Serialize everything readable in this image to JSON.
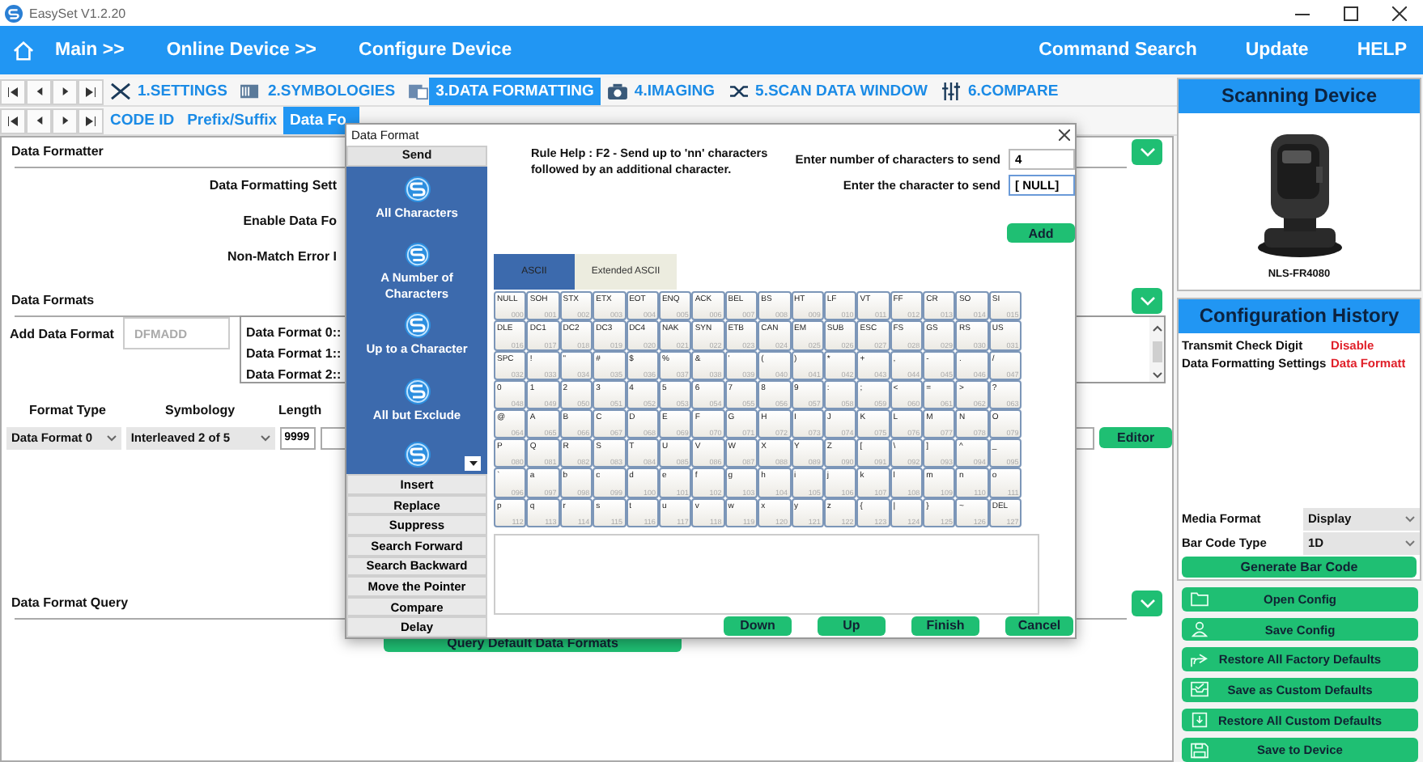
{
  "window": {
    "title": "EasySet V1.2.20"
  },
  "nav": {
    "left": [
      "Main >>",
      "Online Device >>",
      "Configure Device"
    ],
    "right": [
      "Command Search",
      "Update",
      "HELP"
    ]
  },
  "tabs": [
    {
      "label": "1.SETTINGS",
      "selected": false
    },
    {
      "label": "2.SYMBOLOGIES",
      "selected": false
    },
    {
      "label": "3.DATA FORMATTING",
      "selected": true
    },
    {
      "label": "4.IMAGING",
      "selected": false
    },
    {
      "label": "5.SCAN DATA WINDOW",
      "selected": false
    },
    {
      "label": "6.COMPARE",
      "selected": false
    }
  ],
  "subtabs": [
    {
      "label": "CODE ID",
      "selected": false
    },
    {
      "label": "Prefix/Suffix",
      "selected": false
    },
    {
      "label": "Data Fo",
      "selected": true
    }
  ],
  "formatter": {
    "title": "Data Formatter",
    "labels": [
      "Data Formatting Sett",
      "Enable Data Fo",
      "Non-Match Error I"
    ]
  },
  "formats": {
    "title": "Data Formats",
    "add_label": "Add Data Format",
    "add_placeholder": "DFMADD",
    "list": [
      "Data Format 0::",
      "Data Format 1::",
      "Data Format 2::"
    ],
    "columns": [
      "Format Type",
      "Symbology",
      "Length"
    ],
    "format_type": "Data Format 0",
    "symbology": "Interleaved 2 of 5",
    "length": "9999",
    "editor": "Editor"
  },
  "query": {
    "title": "Data Format Query",
    "button": "Query Default Data Formats"
  },
  "device": {
    "title": "Scanning Device",
    "model": "NLS-FR4080"
  },
  "history": {
    "title": "Configuration History",
    "rows": [
      {
        "setting": "Transmit Check Digit",
        "value": "Disable"
      },
      {
        "setting": "Data Formatting Settings",
        "value": "Data Formatt"
      }
    ]
  },
  "media_format": {
    "label": "Media Format",
    "value": "Display"
  },
  "barcode_type": {
    "label": "Bar Code Type",
    "value": "1D"
  },
  "generate": "Generate Bar Code",
  "actions": [
    "Open Config",
    "Save Config",
    "Restore All Factory Defaults",
    "Save as Custom Defaults",
    "Restore All Custom Defaults",
    "Save to Device"
  ],
  "dialog": {
    "title": "Data Format",
    "send_header": "Send",
    "send_items": [
      "All Characters",
      "A Number of Characters",
      "Up to a Character",
      "All but Exclude"
    ],
    "commands": [
      "Insert",
      "Replace",
      "Suppress",
      "Search Forward",
      "Search Backward",
      "Move the Pointer",
      "Compare",
      "Delay"
    ],
    "rule_help": "Rule Help : F2 - Send up to 'nn' characters followed by an additional character.",
    "count_label": "Enter number of characters to send",
    "count_value": "4",
    "char_label": "Enter the character to send",
    "char_value": "[ NULL]",
    "add": "Add",
    "key_tabs": [
      {
        "label": "ASCII",
        "selected": true
      },
      {
        "label": "Extended ASCII",
        "selected": false
      }
    ],
    "keys": [
      {
        "label": "NULL",
        "code": "000"
      },
      {
        "label": "SOH",
        "code": "001"
      },
      {
        "label": "STX",
        "code": "002"
      },
      {
        "label": "ETX",
        "code": "003"
      },
      {
        "label": "EOT",
        "code": "004"
      },
      {
        "label": "ENQ",
        "code": "005"
      },
      {
        "label": "ACK",
        "code": "006"
      },
      {
        "label": "BEL",
        "code": "007"
      },
      {
        "label": "BS",
        "code": "008"
      },
      {
        "label": "HT",
        "code": "009"
      },
      {
        "label": "LF",
        "code": "010"
      },
      {
        "label": "VT",
        "code": "011"
      },
      {
        "label": "FF",
        "code": "012"
      },
      {
        "label": "CR",
        "code": "013"
      },
      {
        "label": "SO",
        "code": "014"
      },
      {
        "label": "SI",
        "code": "015"
      },
      {
        "label": "DLE",
        "code": "016"
      },
      {
        "label": "DC1",
        "code": "017"
      },
      {
        "label": "DC2",
        "code": "018"
      },
      {
        "label": "DC3",
        "code": "019"
      },
      {
        "label": "DC4",
        "code": "020"
      },
      {
        "label": "NAK",
        "code": "021"
      },
      {
        "label": "SYN",
        "code": "022"
      },
      {
        "label": "ETB",
        "code": "023"
      },
      {
        "label": "CAN",
        "code": "024"
      },
      {
        "label": "EM",
        "code": "025"
      },
      {
        "label": "SUB",
        "code": "026"
      },
      {
        "label": "ESC",
        "code": "027"
      },
      {
        "label": "FS",
        "code": "028"
      },
      {
        "label": "GS",
        "code": "029"
      },
      {
        "label": "RS",
        "code": "030"
      },
      {
        "label": "US",
        "code": "031"
      },
      {
        "label": "SPC",
        "code": "032"
      },
      {
        "label": "!",
        "code": "033"
      },
      {
        "label": "\"",
        "code": "034"
      },
      {
        "label": "#",
        "code": "035"
      },
      {
        "label": "$",
        "code": "036"
      },
      {
        "label": "%",
        "code": "037"
      },
      {
        "label": "&",
        "code": "038"
      },
      {
        "label": "'",
        "code": "039"
      },
      {
        "label": "(",
        "code": "040"
      },
      {
        "label": ")",
        "code": "041"
      },
      {
        "label": "*",
        "code": "042"
      },
      {
        "label": "+",
        "code": "043"
      },
      {
        "label": ",",
        "code": "044"
      },
      {
        "label": "-",
        "code": "045"
      },
      {
        "label": ".",
        "code": "046"
      },
      {
        "label": "/",
        "code": "047"
      },
      {
        "label": "0",
        "code": "048"
      },
      {
        "label": "1",
        "code": "049"
      },
      {
        "label": "2",
        "code": "050"
      },
      {
        "label": "3",
        "code": "051"
      },
      {
        "label": "4",
        "code": "052"
      },
      {
        "label": "5",
        "code": "053"
      },
      {
        "label": "6",
        "code": "054"
      },
      {
        "label": "7",
        "code": "055"
      },
      {
        "label": "8",
        "code": "056"
      },
      {
        "label": "9",
        "code": "057"
      },
      {
        "label": ":",
        "code": "058"
      },
      {
        "label": ";",
        "code": "059"
      },
      {
        "label": "<",
        "code": "060"
      },
      {
        "label": "=",
        "code": "061"
      },
      {
        "label": ">",
        "code": "062"
      },
      {
        "label": "?",
        "code": "063"
      },
      {
        "label": "@",
        "code": "064"
      },
      {
        "label": "A",
        "code": "065"
      },
      {
        "label": "B",
        "code": "066"
      },
      {
        "label": "C",
        "code": "067"
      },
      {
        "label": "D",
        "code": "068"
      },
      {
        "label": "E",
        "code": "069"
      },
      {
        "label": "F",
        "code": "070"
      },
      {
        "label": "G",
        "code": "071"
      },
      {
        "label": "H",
        "code": "072"
      },
      {
        "label": "I",
        "code": "073"
      },
      {
        "label": "J",
        "code": "074"
      },
      {
        "label": "K",
        "code": "075"
      },
      {
        "label": "L",
        "code": "076"
      },
      {
        "label": "M",
        "code": "077"
      },
      {
        "label": "N",
        "code": "078"
      },
      {
        "label": "O",
        "code": "079"
      },
      {
        "label": "P",
        "code": "080"
      },
      {
        "label": "Q",
        "code": "081"
      },
      {
        "label": "R",
        "code": "082"
      },
      {
        "label": "S",
        "code": "083"
      },
      {
        "label": "T",
        "code": "084"
      },
      {
        "label": "U",
        "code": "085"
      },
      {
        "label": "V",
        "code": "086"
      },
      {
        "label": "W",
        "code": "087"
      },
      {
        "label": "X",
        "code": "088"
      },
      {
        "label": "Y",
        "code": "089"
      },
      {
        "label": "Z",
        "code": "090"
      },
      {
        "label": "[",
        "code": "091"
      },
      {
        "label": "\\",
        "code": "092"
      },
      {
        "label": "]",
        "code": "093"
      },
      {
        "label": "^",
        "code": "094"
      },
      {
        "label": "_",
        "code": "095"
      },
      {
        "label": "`",
        "code": "096"
      },
      {
        "label": "a",
        "code": "097"
      },
      {
        "label": "b",
        "code": "098"
      },
      {
        "label": "c",
        "code": "099"
      },
      {
        "label": "d",
        "code": "100"
      },
      {
        "label": "e",
        "code": "101"
      },
      {
        "label": "f",
        "code": "102"
      },
      {
        "label": "g",
        "code": "103"
      },
      {
        "label": "h",
        "code": "104"
      },
      {
        "label": "i",
        "code": "105"
      },
      {
        "label": "j",
        "code": "106"
      },
      {
        "label": "k",
        "code": "107"
      },
      {
        "label": "l",
        "code": "108"
      },
      {
        "label": "m",
        "code": "109"
      },
      {
        "label": "n",
        "code": "110"
      },
      {
        "label": "o",
        "code": "111"
      },
      {
        "label": "p",
        "code": "112"
      },
      {
        "label": "q",
        "code": "113"
      },
      {
        "label": "r",
        "code": "114"
      },
      {
        "label": "s",
        "code": "115"
      },
      {
        "label": "t",
        "code": "116"
      },
      {
        "label": "u",
        "code": "117"
      },
      {
        "label": "v",
        "code": "118"
      },
      {
        "label": "w",
        "code": "119"
      },
      {
        "label": "x",
        "code": "120"
      },
      {
        "label": "y",
        "code": "121"
      },
      {
        "label": "z",
        "code": "122"
      },
      {
        "label": "{",
        "code": "123"
      },
      {
        "label": "|",
        "code": "124"
      },
      {
        "label": "}",
        "code": "125"
      },
      {
        "label": "~",
        "code": "126"
      },
      {
        "label": "DEL",
        "code": "127"
      }
    ],
    "buttons": [
      "Down",
      "Up",
      "Finish",
      "Cancel"
    ]
  }
}
